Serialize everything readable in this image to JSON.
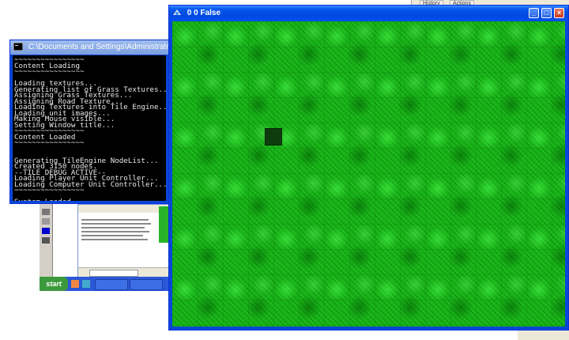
{
  "game_window": {
    "title": "0 0 False",
    "controls": {
      "minimize": "_",
      "maximize": "□",
      "close": "×"
    }
  },
  "console_window": {
    "title": "C:\\Documents and Settings\\Administrator\\My Do",
    "lines": [
      "~~~~~~~~~~~~~~~~",
      "Content Loading",
      "~~~~~~~~~~~~~~~~",
      "",
      "Loading textures...",
      "Generating list of Grass Textures...",
      "Assigning Grass Textures...",
      "Assigning Road Texture...",
      "Loading Textures into Tile Engine...",
      "Loading unit images...",
      "Making Mouse visible...",
      "Setting Window title...",
      "~~~~~~~~~~~~~~~~",
      "Content Loaded",
      "~~~~~~~~~~~~~~~~",
      "",
      "",
      "Generating TileEngine NodeList...",
      "Created 3150 nodes.",
      "--TILE DEBUG ACTIVE--",
      "Loading Player Unit Controller...",
      "Loading Computer Unit Controller...",
      "~~~~~~~~~~~~~~~~",
      "",
      "System Loaded...",
      "~~~~~~~~~~~~~~~~"
    ]
  },
  "background": {
    "top_tabs": [
      "History",
      "Actions"
    ],
    "taskbar": {
      "start_label": "start"
    }
  },
  "colors": {
    "grass": "#17b317",
    "unit_tile": "#0d3d0d",
    "title_bar": "#0a5bf0",
    "console_bg": "#000000",
    "console_text": "#e8e8e8"
  },
  "icons": {
    "title": "window-app-icon",
    "console": "console-app-icon"
  }
}
